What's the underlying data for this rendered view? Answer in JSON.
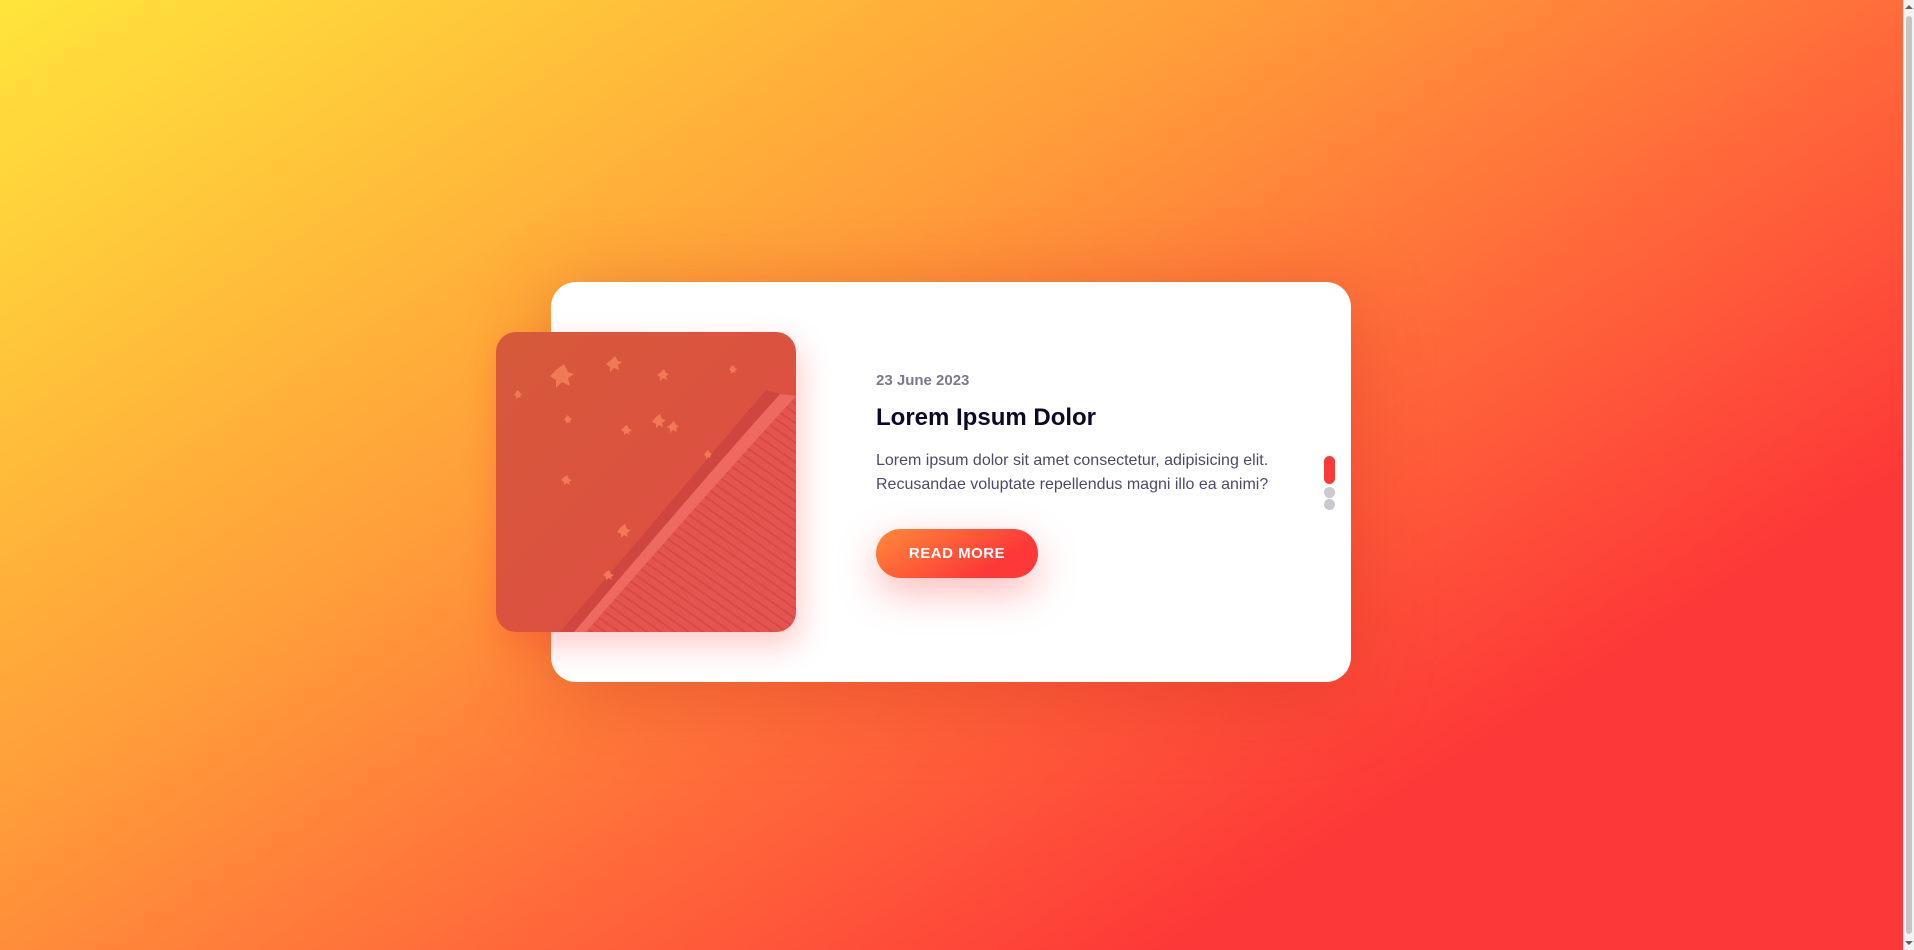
{
  "blog_slider": {
    "date": "23 June 2023",
    "title": "Lorem Ipsum Dolor",
    "text": "Lorem ipsum dolor sit amet consectetur, adipisicing elit. Recusandae voluptate repellendus magni illo ea animi?",
    "button_label": "READ MORE",
    "active_slide": 1,
    "slide_count": 3
  },
  "colors": {
    "accent": "#fd3838",
    "accent_light": "#fe8a39",
    "background_start": "#ffe53b",
    "title": "#0d0925",
    "text": "#4e4a67",
    "date": "#7b7992"
  },
  "icons": {
    "scroll_up": "caret-up-icon",
    "scroll_down": "caret-down-icon"
  }
}
